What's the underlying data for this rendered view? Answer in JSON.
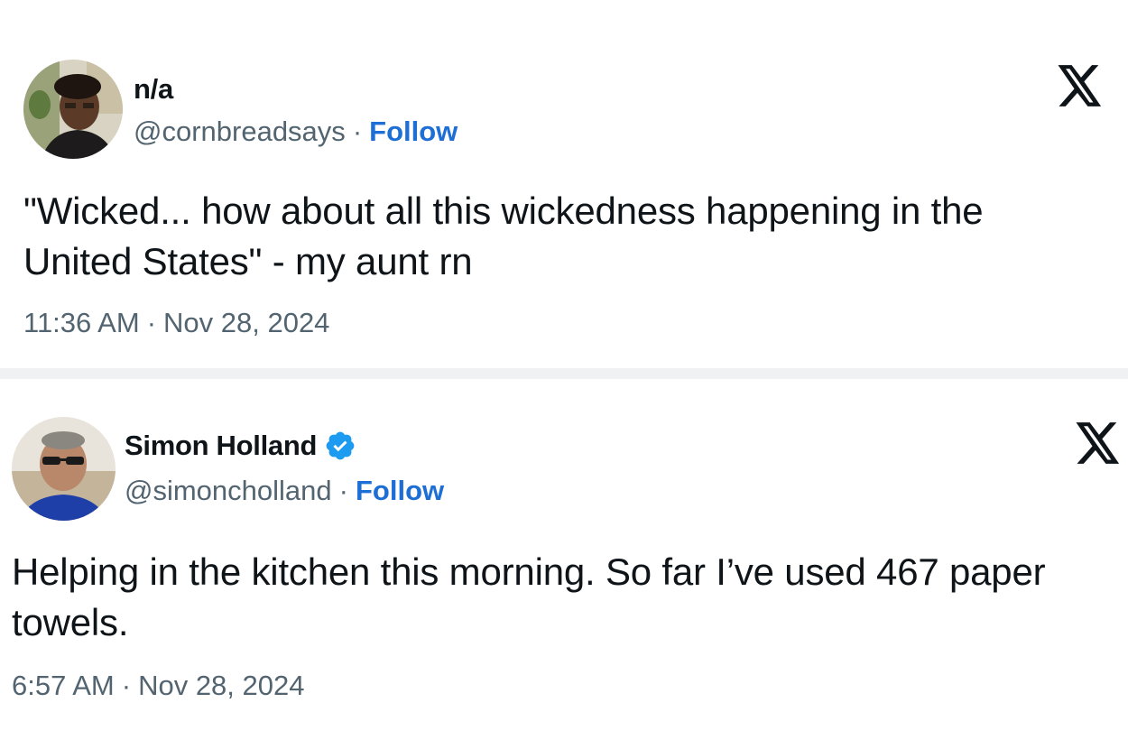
{
  "tweets": [
    {
      "display_name": "n/a",
      "handle": "@cornbreadsays",
      "separator": "·",
      "follow_label": "Follow",
      "verified": false,
      "text": "\"Wicked... how about all this wickedness happening in the United States\" - my aunt rn",
      "time": "11:36 AM",
      "date": "Nov 28, 2024",
      "platform_icon": "x-logo-icon"
    },
    {
      "display_name": "Simon Holland",
      "handle": "@simoncholland",
      "separator": "·",
      "follow_label": "Follow",
      "verified": true,
      "text": "Helping in the kitchen this morning. So far I’ve used 467 paper towels.",
      "time": "6:57 AM",
      "date": "Nov 28, 2024",
      "platform_icon": "x-logo-icon"
    }
  ],
  "colors": {
    "text_primary": "#0f1419",
    "text_secondary": "#536471",
    "link_blue": "#1d6fd6",
    "verified_blue": "#1d9bf0",
    "divider": "#eff1f3"
  }
}
